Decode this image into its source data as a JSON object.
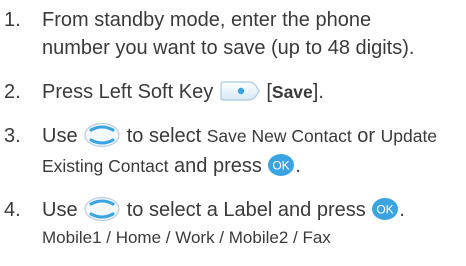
{
  "steps": [
    {
      "number": "1.",
      "line1": "From standby mode, enter the phone",
      "line2": "number you want to save (up to 48 digits)."
    },
    {
      "number": "2.",
      "pre": "Press Left Soft Key",
      "icon": "left-soft-key-icon",
      "bracket_open": "[",
      "action": "Save",
      "bracket_close": "]."
    },
    {
      "number": "3.",
      "pre": "Use",
      "icon": "navigation-key-icon",
      "mid": "to select",
      "opt1": "Save New Contact",
      "or": "or",
      "opt2a": "Update",
      "opt2b": "Existing Contact",
      "and_press": "and press",
      "ok_icon": "ok-key-icon",
      "end": "."
    },
    {
      "number": "4.",
      "pre": "Use",
      "icon": "navigation-key-icon",
      "mid": "to select a Label and press",
      "ok_icon": "ok-key-icon",
      "end": ".",
      "options": "Mobile1 / Home / Work / Mobile2 / Fax"
    }
  ],
  "colors": {
    "text": "#3a3a3a",
    "ok_key": "#3aa3e0",
    "key_outline": "#3aa3e0"
  }
}
